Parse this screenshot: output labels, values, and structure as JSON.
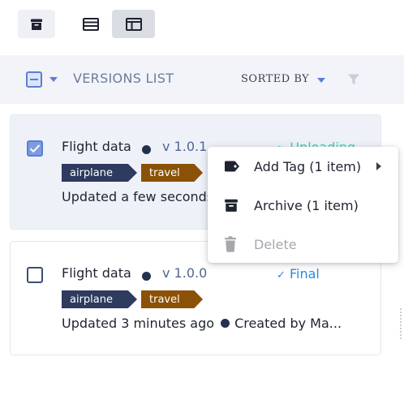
{
  "toolbar": {
    "buttons": [
      {
        "icon": "archive-icon"
      },
      {
        "icon": "list-view-icon"
      },
      {
        "icon": "details-view-icon"
      }
    ]
  },
  "list_header": {
    "title": "VERSIONS LIST",
    "sorted_by_label": "SORTED BY",
    "select_state": "indeterminate",
    "filter_icon": "filter-icon"
  },
  "versions": [
    {
      "name": "Flight data",
      "version": "v 1.0.1",
      "status": "Uploading",
      "status_icon": "play-outline-icon",
      "status_color": "#37d3b6",
      "tags": [
        {
          "label": "airplane",
          "color": "#2e3a5e"
        },
        {
          "label": "travel",
          "color": "#8b5107"
        }
      ],
      "meta": "Updated a few seconds ago",
      "selected": true
    },
    {
      "name": "Flight data",
      "version": "v 1.0.0",
      "status": "Final",
      "status_icon": "check-icon",
      "status_color": "#2b8ae0",
      "tags": [
        {
          "label": "airplane",
          "color": "#2e3a5e"
        },
        {
          "label": "travel",
          "color": "#8b5107"
        }
      ],
      "meta": "Updated 3 minutes ago",
      "created_by": "Created by Ma...",
      "selected": false
    }
  ],
  "context_menu": {
    "items": [
      {
        "label": "Add Tag (1 item)",
        "icon": "tag-icon",
        "has_submenu": true,
        "enabled": true
      },
      {
        "label": "Archive (1 item)",
        "icon": "archive-icon",
        "enabled": true
      },
      {
        "label": "Delete",
        "icon": "trash-icon",
        "enabled": false
      }
    ]
  },
  "colors": {
    "accent": "#5b7fd6",
    "selected_row_bg": "#eef1f8",
    "header_bg": "#f2f4f9"
  }
}
